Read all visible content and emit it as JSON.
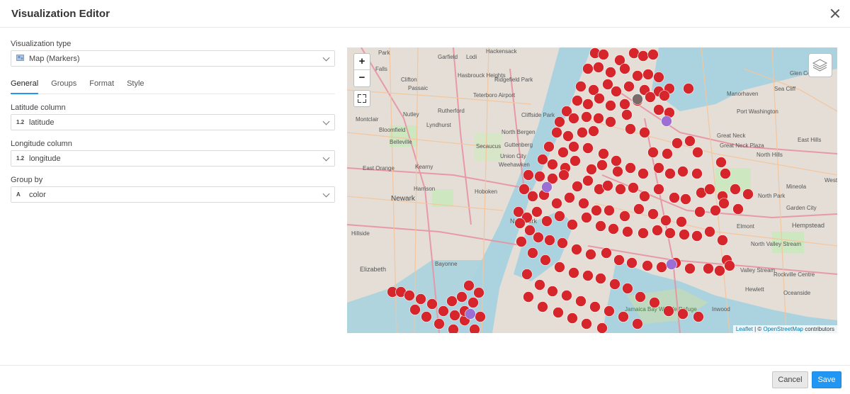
{
  "window": {
    "title": "Visualization Editor"
  },
  "viz_type": {
    "label": "Visualization type",
    "value": "Map (Markers)",
    "icon": "map-markers-icon"
  },
  "tabs": [
    {
      "label": "General",
      "active": true
    },
    {
      "label": "Groups",
      "active": false
    },
    {
      "label": "Format",
      "active": false
    },
    {
      "label": "Style",
      "active": false
    }
  ],
  "latitude": {
    "label": "Latitude column",
    "type_badge": "1.2",
    "value": "latitude"
  },
  "longitude": {
    "label": "Longitude column",
    "type_badge": "1.2",
    "value": "longitude"
  },
  "group_by": {
    "label": "Group by",
    "type_badge": "A",
    "value": "color"
  },
  "map": {
    "zoom_in": "+",
    "zoom_out": "−",
    "attribution_leaflet": "Leaflet",
    "attribution_sep": " | © ",
    "attribution_osm": "OpenStreetMap",
    "attribution_tail": " contributors",
    "marker_colors": {
      "red": "#d7262b",
      "purple": "#9b6fd4",
      "gray": "#7a6a6a"
    },
    "place_labels": [
      "Park",
      "Garfield",
      "Lodi",
      "Hackensack",
      "Falls",
      "Clifton",
      "Passaic",
      "Hasbrouck Heights",
      "Ridgefield Park",
      "Teterboro Airport",
      "Nutley",
      "Rutherford",
      "Montclair",
      "Lyndhurst",
      "Cliffside Park",
      "Bloomfield",
      "Belleville",
      "North Bergen",
      "Guttenberg",
      "Secaucus",
      "Union City",
      "Weehawken",
      "East Orange",
      "Kearny",
      "Harrison",
      "Newark",
      "Hoboken",
      "Hillside",
      "Elizabeth",
      "Bayonne",
      "New York",
      "Manorhaven",
      "Sea Cliff",
      "Glen Co",
      "Port Washington",
      "Great Neck",
      "Great Neck Plaza",
      "North Hills",
      "East Hills",
      "Mineola",
      "North Park",
      "Garden City",
      "Elmont",
      "Hempstead",
      "North Valley Stream",
      "Valley Stream",
      "Rockville Centre",
      "Hewlett",
      "Oceanside",
      "Inwood",
      "Jamaica Bay Wildlife Refuge",
      "Westb"
    ]
  },
  "footer": {
    "cancel_label": "Cancel",
    "save_label": "Save"
  }
}
